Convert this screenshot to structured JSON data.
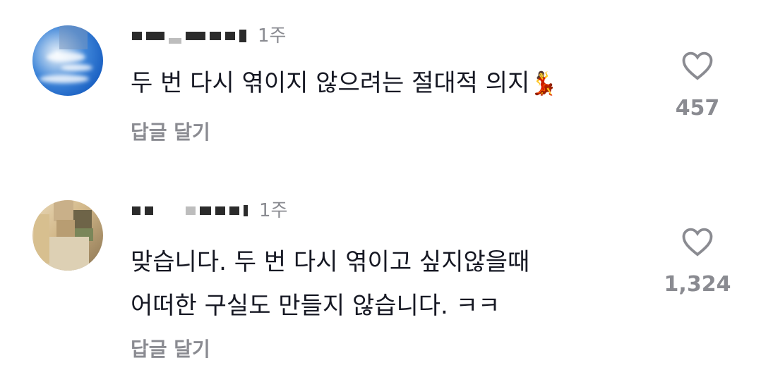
{
  "comments": [
    {
      "time": "1주",
      "text": "두 번 다시 엮이지 않으려는 절대적 의지",
      "emoji": "💃",
      "reply_label": "답글 달기",
      "like_count": "457",
      "like_icon": "heart-outline-icon"
    },
    {
      "time": "1주",
      "text_line1": "맞습니다. 두 번 다시 엮이고 싶지않을때",
      "text_line2": "어떠한 구실도 만들지 않습니다. ㅋㅋ",
      "reply_label": "답글 달기",
      "like_count": "1,324",
      "like_icon": "heart-outline-icon"
    }
  ],
  "colors": {
    "text_primary": "#161823",
    "text_secondary": "#8a8b91",
    "background": "#ffffff"
  }
}
